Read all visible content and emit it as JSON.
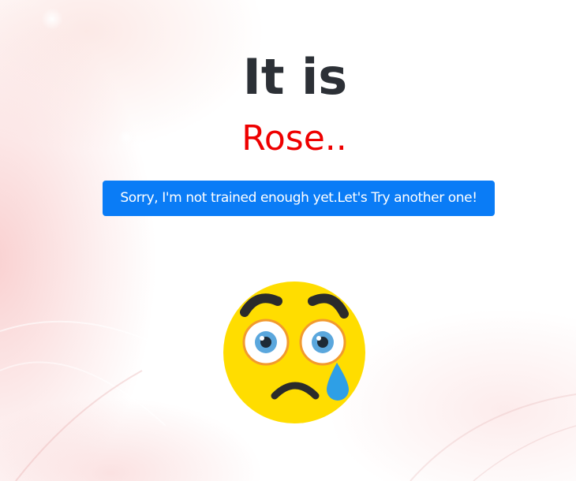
{
  "heading": "It is",
  "prediction": "Rose..",
  "retry_button_label": "Sorry, I'm not trained enough yet.Let's Try another one!",
  "emoji_icon": "crying-face-icon",
  "colors": {
    "heading": "#2c3036",
    "prediction": "#ee0000",
    "button": "#0a7cf6",
    "button_text": "#ffffff",
    "emoji_face": "#ffdd00",
    "tear": "#2e9fe6"
  }
}
